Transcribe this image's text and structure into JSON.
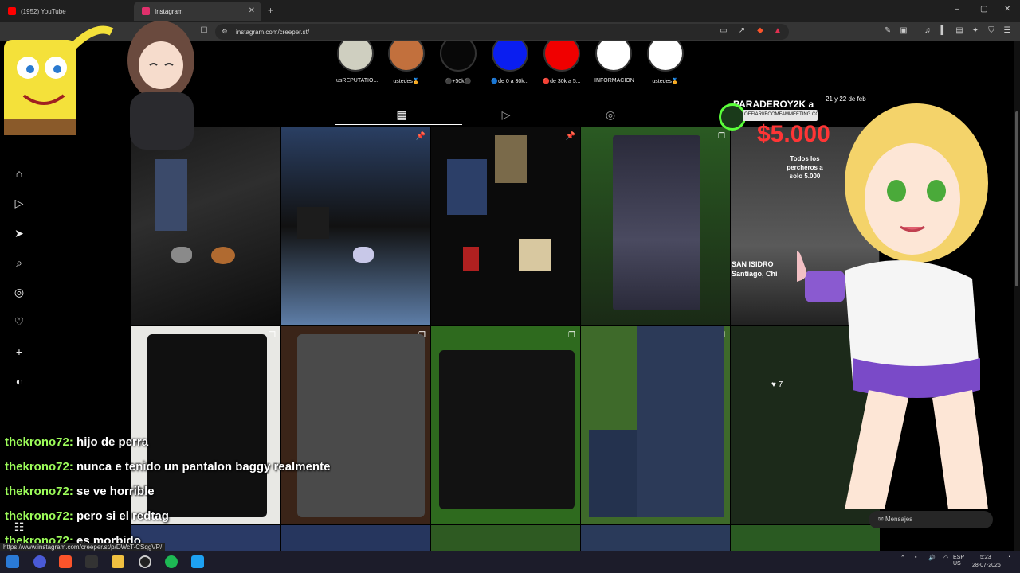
{
  "browser": {
    "tabs": [
      {
        "title": "(1952) YouTube",
        "color": "#ff0000"
      },
      {
        "title": "Instagram",
        "color": "#e1306c"
      }
    ],
    "url": "instagram.com/creeper.st/",
    "window_controls": [
      "–",
      "▢",
      "✕"
    ]
  },
  "highlights": [
    {
      "label": "usREPUTATIO...",
      "color": "#cfcfc0"
    },
    {
      "label": "ustedes🏅",
      "color": "#c2703d"
    },
    {
      "label": "⚫+50k⚫",
      "color": "#080808"
    },
    {
      "label": "🔵de 0 a 30k...",
      "color": "#0a1ef0"
    },
    {
      "label": "🔴de 30k a 5...",
      "color": "#f00000"
    },
    {
      "label": "INFORMACION",
      "color": "#ffffff"
    },
    {
      "label": "ustedes🏅",
      "color": "#ffffff"
    }
  ],
  "profile_tabs": [
    "posts-grid",
    "reels",
    "tagged"
  ],
  "sidenav": [
    "home-icon",
    "reels-icon",
    "send-icon",
    "search-icon",
    "explore-icon",
    "heart-icon",
    "create-icon",
    "profile-icon"
  ],
  "ad": {
    "title": "PARADEROY2K a",
    "date": "21 y 22 de feb",
    "price": "$5.000",
    "sub": "Todos los percheros a solo 5.000",
    "location_1": "SAN ISIDRO",
    "location_2": "Santiago, Chi"
  },
  "badge_text": "OFFIARI/BOOMFAMMEETING.COM",
  "like_count": "7",
  "chat": [
    {
      "user": "thekrono72:",
      "msg": "hijo de perra"
    },
    {
      "user": "thekrono72:",
      "msg": "nunca e tenido un pantalon baggy realmente"
    },
    {
      "user": "thekrono72:",
      "msg": "se ve horrible"
    },
    {
      "user": "thekrono72:",
      "msg": "pero si el redtag"
    },
    {
      "user": "thekrono72:",
      "msg": "es morbido"
    }
  ],
  "status_url": "https://www.instagram.com/creeper.st/p/DWcT-CSqgVP/",
  "messages_pill": "Mensajes",
  "system_tray": {
    "lang": "ESP\nUS",
    "time": "5:23",
    "date": "28-07-2026"
  }
}
